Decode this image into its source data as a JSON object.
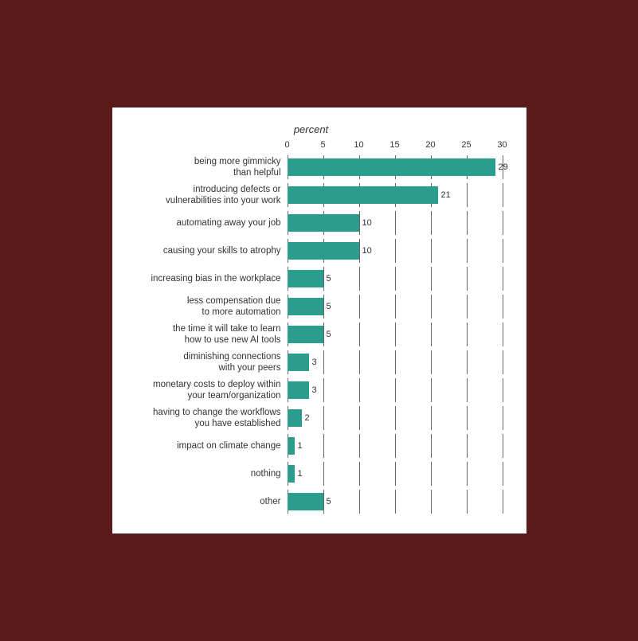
{
  "chart": {
    "title": "percent",
    "bar_color": "#2a9d8f",
    "axis": {
      "max": 30,
      "ticks": [
        0,
        5,
        10,
        15,
        20,
        25,
        30
      ]
    },
    "rows": [
      {
        "label": "being more gimmicky\nthan helpful",
        "value": 29
      },
      {
        "label": "introducing defects or\nvulnerabilities into your work",
        "value": 21
      },
      {
        "label": "automating away your job",
        "value": 10
      },
      {
        "label": "causing your skills to atrophy",
        "value": 10
      },
      {
        "label": "increasing bias in the workplace",
        "value": 5
      },
      {
        "label": "less compensation due\nto more automation",
        "value": 5
      },
      {
        "label": "the time it will take to learn\nhow to use new AI tools",
        "value": 5
      },
      {
        "label": "diminishing connections\nwith your peers",
        "value": 3
      },
      {
        "label": "monetary costs to deploy within\nyour team/organization",
        "value": 3
      },
      {
        "label": "having to change the workflows\nyou have established",
        "value": 2
      },
      {
        "label": "impact on climate change",
        "value": 1
      },
      {
        "label": "nothing",
        "value": 1
      },
      {
        "label": "other",
        "value": 5
      }
    ]
  }
}
